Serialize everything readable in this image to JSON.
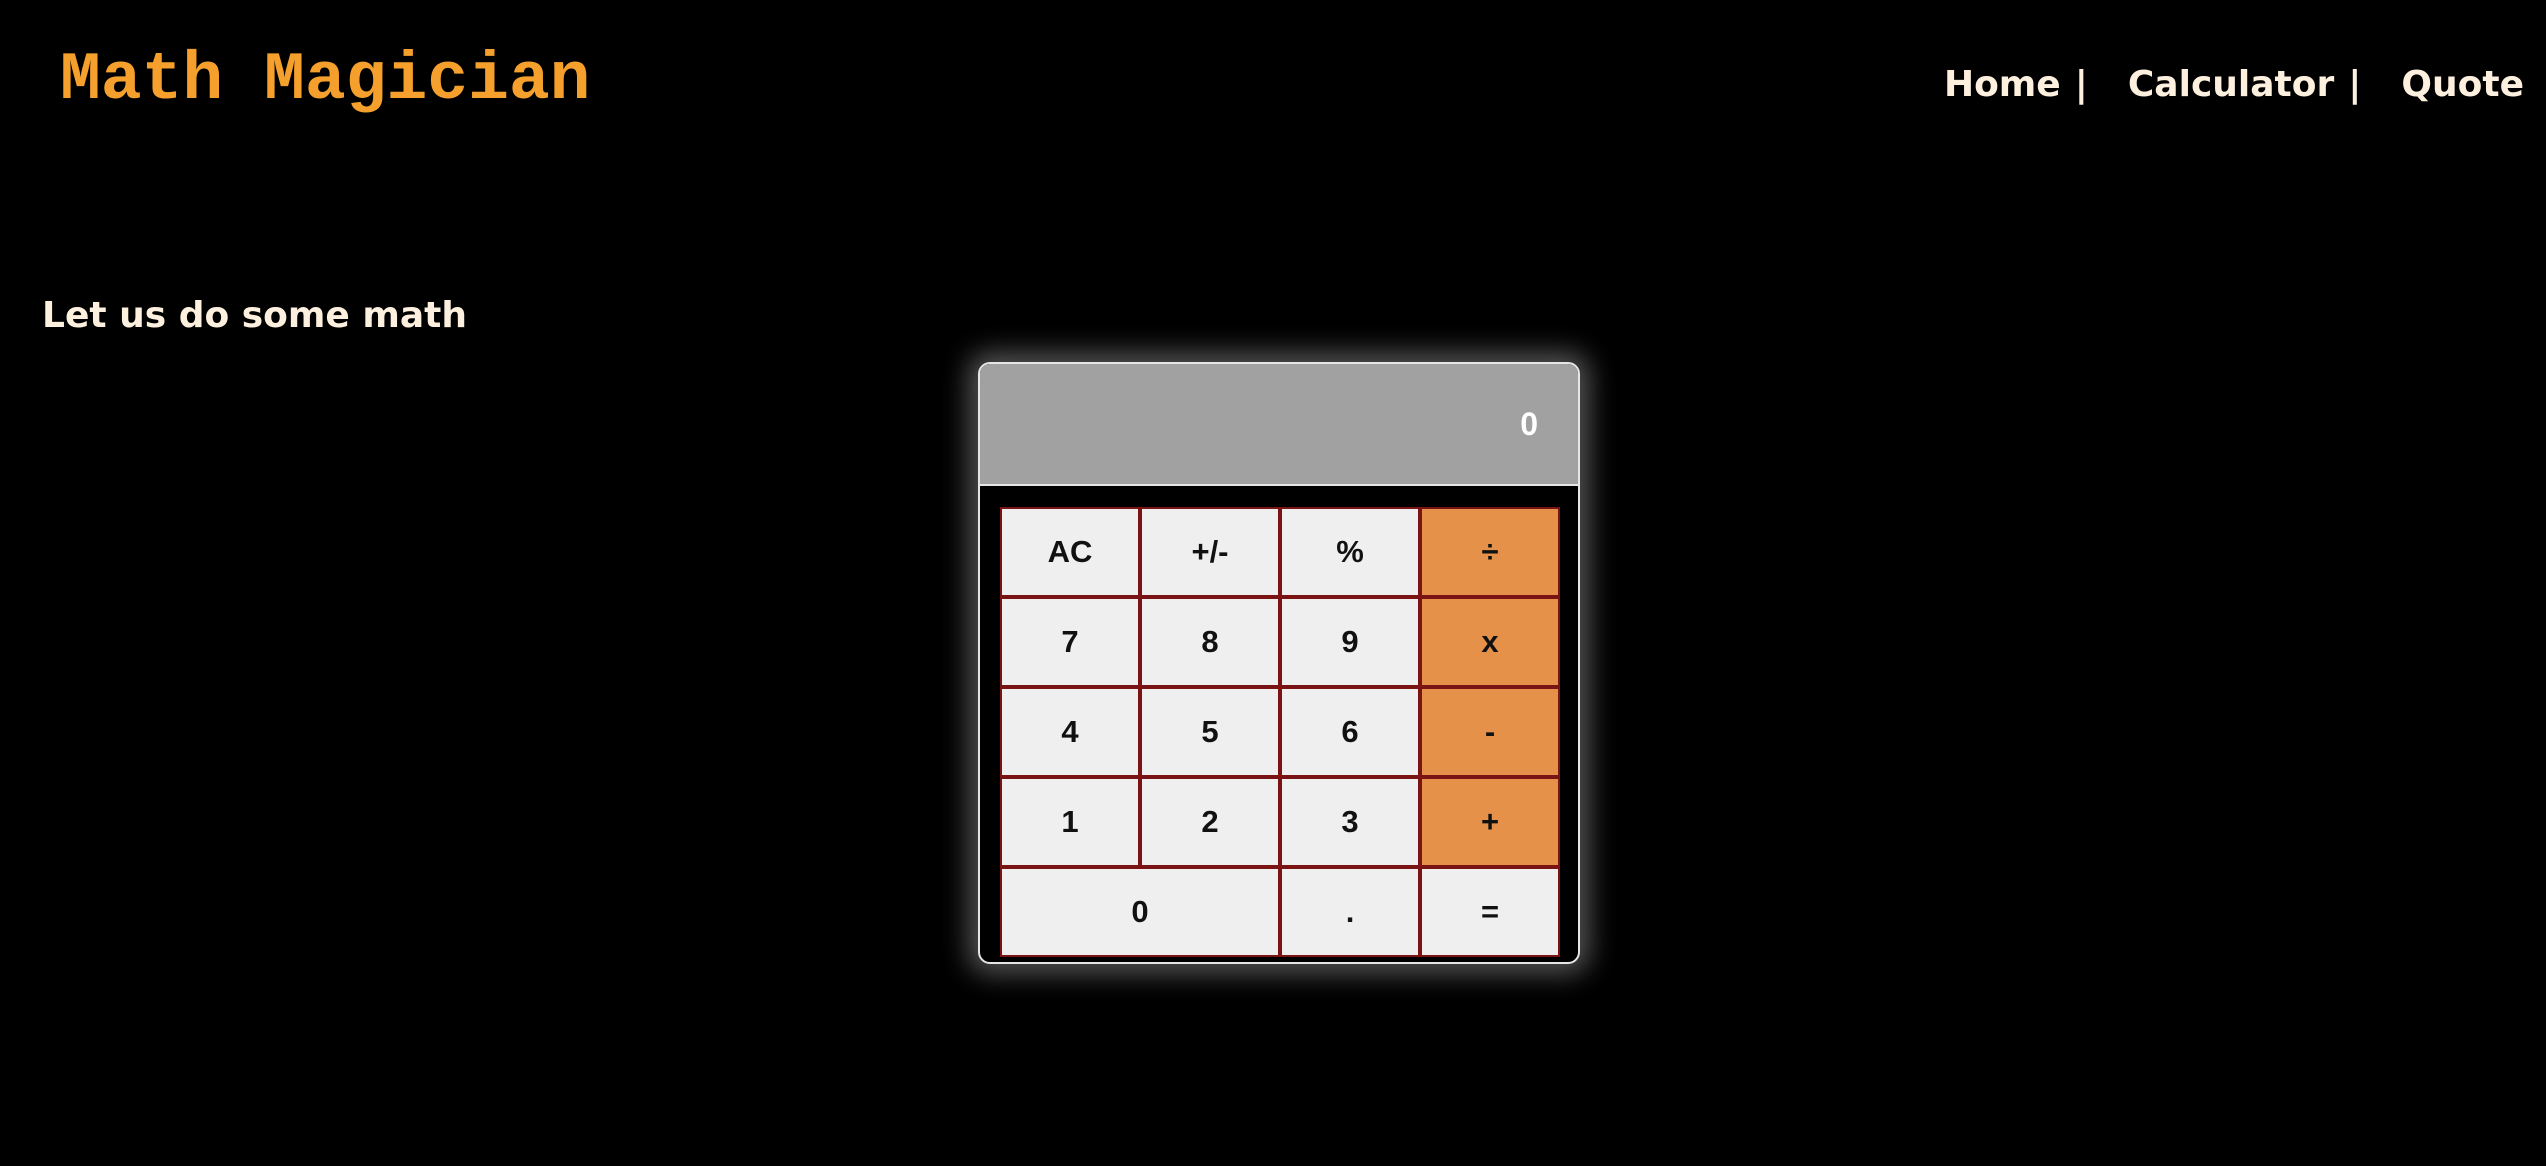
{
  "header": {
    "logo": "Math Magician",
    "nav": [
      {
        "label": "Home",
        "separator": "|"
      },
      {
        "label": "Calculator",
        "separator": "|"
      },
      {
        "label": "Quote",
        "separator": ""
      }
    ]
  },
  "main": {
    "intro": "Let us do some math"
  },
  "calculator": {
    "display": "0",
    "rows": [
      [
        "AC",
        "+/-",
        "%",
        "÷"
      ],
      [
        "7",
        "8",
        "9",
        "x"
      ],
      [
        "4",
        "5",
        "6",
        "-"
      ],
      [
        "1",
        "2",
        "3",
        "+"
      ],
      [
        "0",
        ".",
        "="
      ]
    ]
  },
  "colors": {
    "background": "#000000",
    "brand": "#f5a02c",
    "nav_text": "#fdf0de",
    "display_bg": "#a1a1a1",
    "key_bg": "#efefef",
    "operator_bg": "#e5914a",
    "key_border": "#7a1313"
  }
}
